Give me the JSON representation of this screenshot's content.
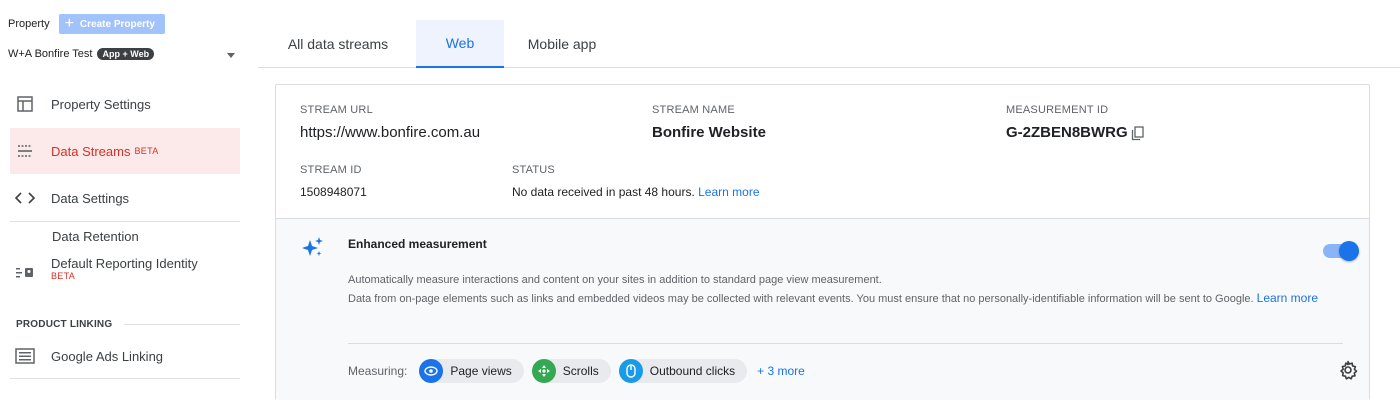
{
  "property": {
    "label": "Property",
    "create_label": "Create Property",
    "name": "W+A Bonfire Test",
    "badge": "App + Web"
  },
  "nav": {
    "property_settings": "Property Settings",
    "data_streams": "Data Streams",
    "data_streams_beta": "BETA",
    "data_settings": "Data Settings",
    "data_retention": "Data Retention",
    "default_reporting_identity": "Default Reporting Identity",
    "default_reporting_beta": "BETA",
    "product_linking": "PRODUCT LINKING",
    "google_ads_linking": "Google Ads Linking"
  },
  "tabs": {
    "all": "All data streams",
    "web": "Web",
    "mobile": "Mobile app"
  },
  "stream": {
    "url_label": "STREAM URL",
    "url": "https://www.bonfire.com.au",
    "name_label": "STREAM NAME",
    "name": "Bonfire Website",
    "mid_label": "MEASUREMENT ID",
    "mid": "G-2ZBEN8BWRG",
    "id_label": "STREAM ID",
    "id": "1508948071",
    "status_label": "STATUS",
    "status": "No data received in past 48 hours.",
    "status_link": "Learn more"
  },
  "enhanced": {
    "title": "Enhanced measurement",
    "desc1": "Automatically measure interactions and content on your sites in addition to standard page view measurement.",
    "desc2": "Data from on-page elements such as links and embedded videos may be collected with relevant events. You must ensure that no personally-identifiable information will be sent to Google.",
    "learn_more": "Learn more",
    "measuring_label": "Measuring:",
    "chips": [
      "Page views",
      "Scrolls",
      "Outbound clicks"
    ],
    "more": "+ 3 more",
    "enabled": true
  },
  "colors": {
    "accent": "#1a73e8",
    "active_red": "#d93025",
    "chip_page_views": "#1a73e8",
    "chip_scrolls": "#34a853",
    "chip_outbound": "#1a9be8"
  }
}
